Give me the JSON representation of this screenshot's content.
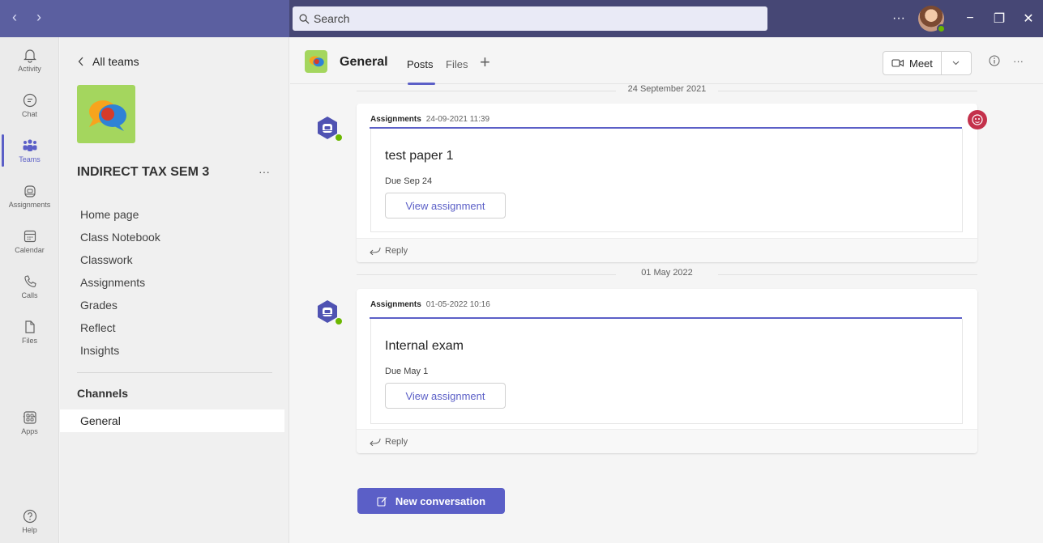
{
  "titlebar": {
    "nav_back": "‹",
    "nav_forward": "›",
    "search_placeholder": "Search",
    "more": "···",
    "minimize": "−",
    "restore": "❐",
    "close": "✕"
  },
  "rail": {
    "items": [
      {
        "label": "Activity",
        "icon": "bell-icon"
      },
      {
        "label": "Chat",
        "icon": "chat-icon"
      },
      {
        "label": "Teams",
        "icon": "teams-icon",
        "active": true
      },
      {
        "label": "Assignments",
        "icon": "assignments-icon"
      },
      {
        "label": "Calendar",
        "icon": "calendar-icon"
      },
      {
        "label": "Calls",
        "icon": "phone-icon"
      },
      {
        "label": "Files",
        "icon": "file-icon"
      },
      {
        "label": "Apps",
        "icon": "apps-icon"
      },
      {
        "label": "Help",
        "icon": "help-icon"
      }
    ],
    "more": "···"
  },
  "team": {
    "back_label": "All teams",
    "name": "INDIRECT TAX SEM 3",
    "more": "···",
    "links": [
      "Home page",
      "Class Notebook",
      "Classwork",
      "Assignments",
      "Grades",
      "Reflect",
      "Insights"
    ],
    "channels_heading": "Channels",
    "channels": [
      "General"
    ]
  },
  "channel": {
    "title": "General",
    "tabs": [
      "Posts",
      "Files"
    ],
    "add_tab": "+",
    "meet_label": "Meet",
    "more": "···"
  },
  "feed": {
    "posts": [
      {
        "date_separator": "24 September 2021",
        "author": "Assignments",
        "timestamp": "24-09-2021 11:39",
        "card_title": "test paper 1",
        "due": "Due Sep 24",
        "button": "View assignment",
        "reply": "Reply"
      },
      {
        "date_separator": "01 May 2022",
        "author": "Assignments",
        "timestamp": "01-05-2022 10:16",
        "card_title": "Internal exam",
        "due": "Due May 1",
        "button": "View assignment",
        "reply": "Reply"
      }
    ],
    "new_conversation": "New conversation"
  },
  "colors": {
    "titlebar": "#464775",
    "accent": "#5b5fc7",
    "team_logo_bg": "#a4d65e",
    "presence_green": "#6bb700",
    "badge_red": "#c4314b"
  }
}
